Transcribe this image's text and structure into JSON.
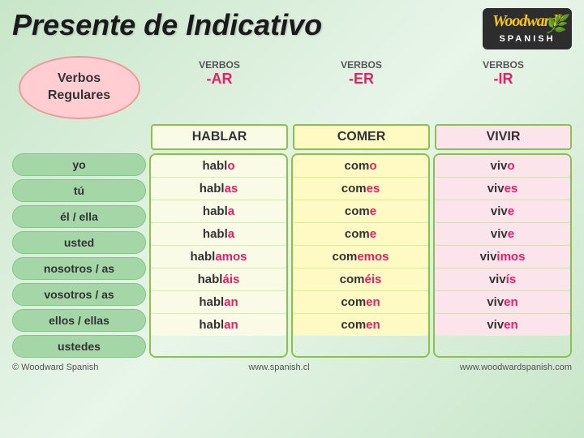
{
  "header": {
    "title": "Presente de Indicativo",
    "logo": {
      "brand": "Woodward",
      "reg": "®",
      "sub": "SPANISH"
    }
  },
  "sidebar": {
    "label1": "Verbos",
    "label2": "Regulares"
  },
  "columns": [
    {
      "verbos_label": "VERBOS",
      "ending": "-AR",
      "verb": "HABLAR",
      "color_class": "conj-ar"
    },
    {
      "verbos_label": "VERBOS",
      "ending": "-ER",
      "verb": "COMER",
      "color_class": "conj-er"
    },
    {
      "verbos_label": "VERBOS",
      "ending": "-IR",
      "verb": "VIVIR",
      "color_class": "conj-ir"
    }
  ],
  "rows": [
    {
      "pronoun": "yo",
      "ar_stem": "habl",
      "ar_end": "o",
      "er_stem": "com",
      "er_end": "o",
      "ir_stem": "viv",
      "ir_end": "o"
    },
    {
      "pronoun": "tú",
      "ar_stem": "habl",
      "ar_end": "as",
      "er_stem": "com",
      "er_end": "es",
      "ir_stem": "viv",
      "ir_end": "es"
    },
    {
      "pronoun": "él / ella",
      "ar_stem": "habl",
      "ar_end": "a",
      "er_stem": "com",
      "er_end": "e",
      "ir_stem": "viv",
      "ir_end": "e"
    },
    {
      "pronoun": "usted",
      "ar_stem": "habl",
      "ar_end": "a",
      "er_stem": "com",
      "er_end": "e",
      "ir_stem": "viv",
      "ir_end": "e"
    },
    {
      "pronoun": "nosotros / as",
      "ar_stem": "habl",
      "ar_end": "amos",
      "er_stem": "com",
      "er_end": "emos",
      "ir_stem": "viv",
      "ir_end": "imos"
    },
    {
      "pronoun": "vosotros / as",
      "ar_stem": "habl",
      "ar_end": "áis",
      "er_stem": "com",
      "er_end": "éis",
      "ir_stem": "viv",
      "ir_end": "ís"
    },
    {
      "pronoun": "ellos / ellas",
      "ar_stem": "habl",
      "ar_end": "an",
      "er_stem": "com",
      "er_end": "en",
      "ir_stem": "viv",
      "ir_end": "en"
    },
    {
      "pronoun": "ustedes",
      "ar_stem": "habl",
      "ar_end": "an",
      "er_stem": "com",
      "er_end": "en",
      "ir_stem": "viv",
      "ir_end": "en"
    }
  ],
  "footer": {
    "left": "© Woodward Spanish",
    "center": "www.spanish.cl",
    "right": "www.woodwardspanish.com"
  }
}
